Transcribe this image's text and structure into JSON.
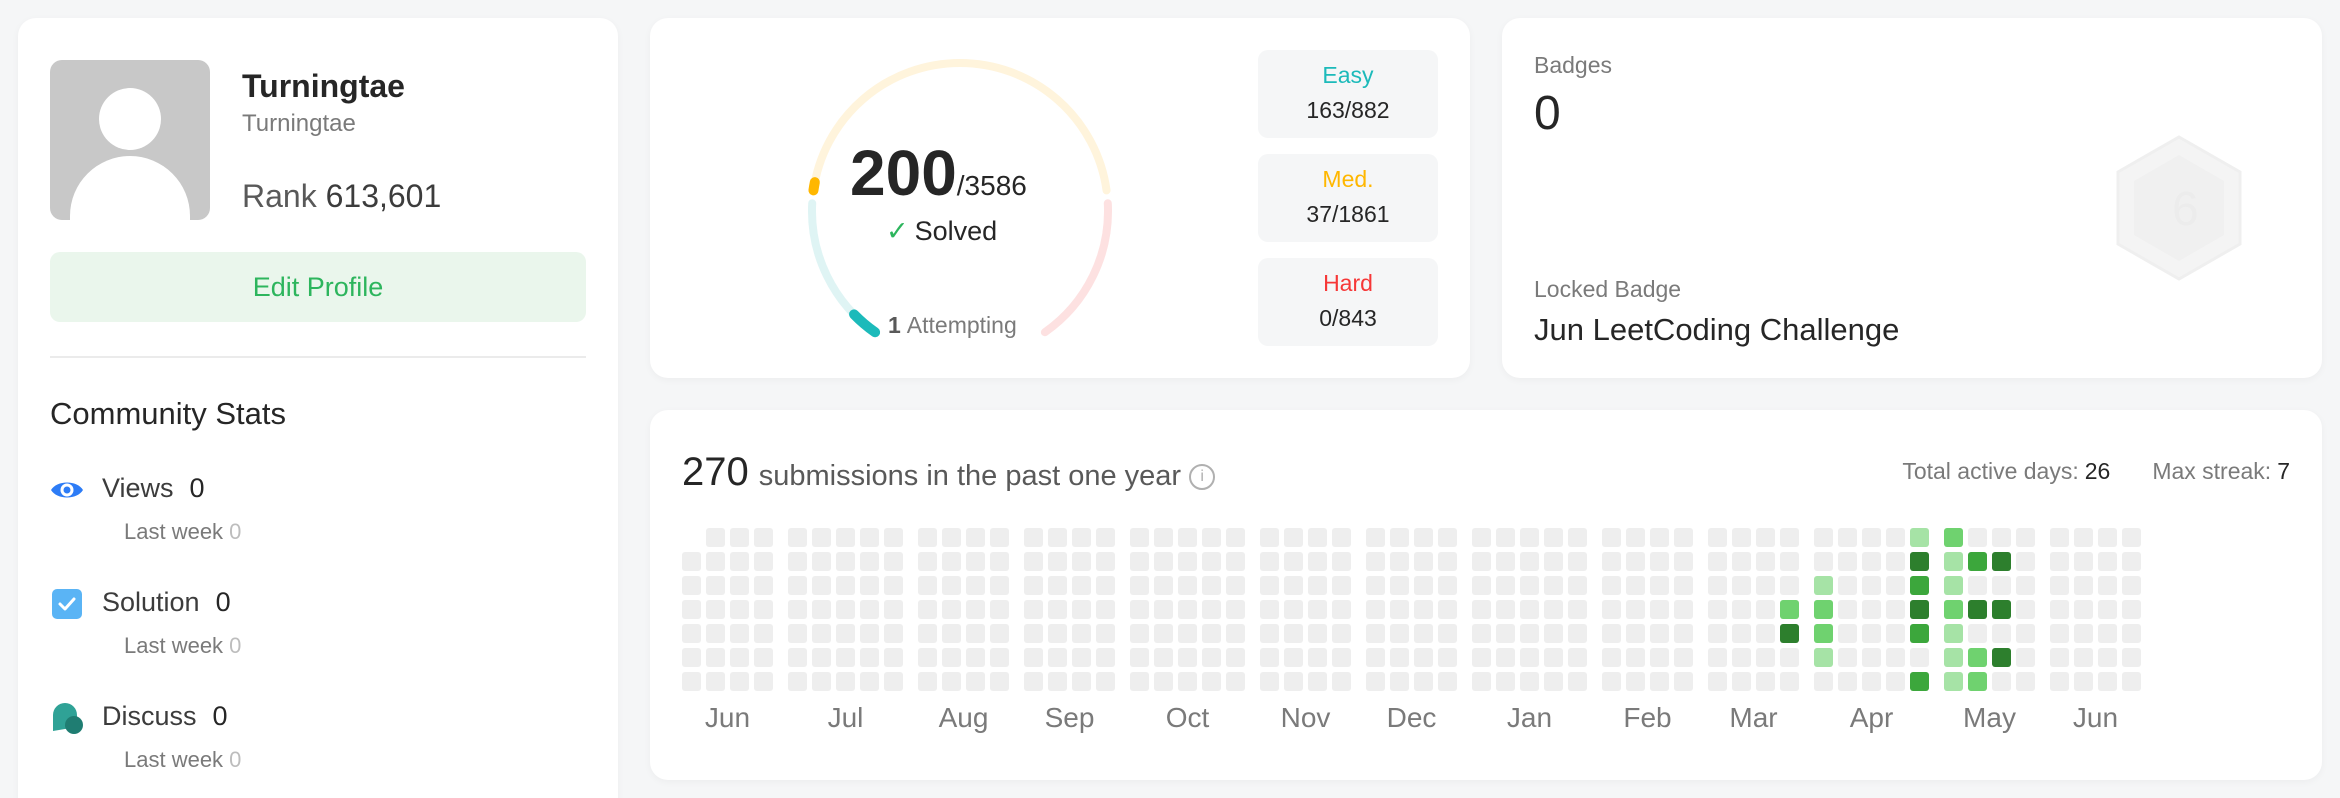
{
  "profile": {
    "name": "Turningtae",
    "handle": "Turningtae",
    "rank_label": "Rank",
    "rank_value": "613,601",
    "edit_label": "Edit Profile",
    "avatar_icon": "default-user-avatar"
  },
  "community": {
    "title": "Community Stats",
    "stats": [
      {
        "label": "Views",
        "value": "0",
        "sub_label": "Last week",
        "sub_value": "0",
        "icon": "eye-icon",
        "color": "#2d7cf6"
      },
      {
        "label": "Solution",
        "value": "0",
        "sub_label": "Last week",
        "sub_value": "0",
        "icon": "check-square-icon",
        "color": "#5ab4f5"
      },
      {
        "label": "Discuss",
        "value": "0",
        "sub_label": "Last week",
        "sub_value": "0",
        "icon": "discuss-bubble-icon",
        "color": "#2fa296"
      }
    ]
  },
  "solved": {
    "count": "200",
    "total": "/3586",
    "solved_label": "Solved",
    "attempting_count": "1",
    "attempting_label": "Attempting",
    "difficulties": [
      {
        "name": "Easy",
        "value": "163/882",
        "color": "#1cbaba",
        "solved": 163,
        "total": 882
      },
      {
        "name": "Med.",
        "value": "37/1861",
        "color": "#ffb700",
        "solved": 37,
        "total": 1861
      },
      {
        "name": "Hard",
        "value": "0/843",
        "color": "#f63737",
        "solved": 0,
        "total": 843
      }
    ]
  },
  "badges": {
    "label": "Badges",
    "count": "0",
    "locked_label": "Locked Badge",
    "locked_name": "Jun LeetCoding Challenge",
    "locked_icon": "hexagon-badge-icon"
  },
  "submissions": {
    "count": "270",
    "label": "submissions in the past one year",
    "info_icon": "info-icon",
    "active_days_label": "Total active days:",
    "active_days": "26",
    "max_streak_label": "Max streak:",
    "max_streak": "7",
    "months": [
      "Jun",
      "Jul",
      "Aug",
      "Sep",
      "Oct",
      "Nov",
      "Dec",
      "Jan",
      "Feb",
      "Mar",
      "Apr",
      "May",
      "Jun"
    ],
    "colors": {
      "empty": "#eeeeee",
      "l1": "#a6e3a6",
      "l2": "#6fd26f",
      "l3": "#3ca73c",
      "l4": "#2d7f2d"
    },
    "active_cells": [
      {
        "week": 42,
        "day": 3,
        "level": 2
      },
      {
        "week": 42,
        "day": 4,
        "level": 4
      },
      {
        "week": 43,
        "day": 2,
        "level": 1
      },
      {
        "week": 43,
        "day": 3,
        "level": 2
      },
      {
        "week": 43,
        "day": 4,
        "level": 2
      },
      {
        "week": 43,
        "day": 5,
        "level": 1
      },
      {
        "week": 47,
        "day": 0,
        "level": 1
      },
      {
        "week": 47,
        "day": 1,
        "level": 4
      },
      {
        "week": 47,
        "day": 2,
        "level": 3
      },
      {
        "week": 47,
        "day": 3,
        "level": 4
      },
      {
        "week": 47,
        "day": 4,
        "level": 3
      },
      {
        "week": 47,
        "day": 6,
        "level": 3
      },
      {
        "week": 48,
        "day": 0,
        "level": 2
      },
      {
        "week": 48,
        "day": 1,
        "level": 1
      },
      {
        "week": 48,
        "day": 2,
        "level": 1
      },
      {
        "week": 48,
        "day": 3,
        "level": 2
      },
      {
        "week": 48,
        "day": 4,
        "level": 1
      },
      {
        "week": 48,
        "day": 5,
        "level": 1
      },
      {
        "week": 48,
        "day": 6,
        "level": 1
      },
      {
        "week": 49,
        "day": 1,
        "level": 3
      },
      {
        "week": 49,
        "day": 3,
        "level": 4
      },
      {
        "week": 49,
        "day": 5,
        "level": 2
      },
      {
        "week": 49,
        "day": 6,
        "level": 2
      },
      {
        "week": 50,
        "day": 1,
        "level": 4
      },
      {
        "week": 50,
        "day": 3,
        "level": 4
      },
      {
        "week": 50,
        "day": 5,
        "level": 4
      }
    ]
  }
}
